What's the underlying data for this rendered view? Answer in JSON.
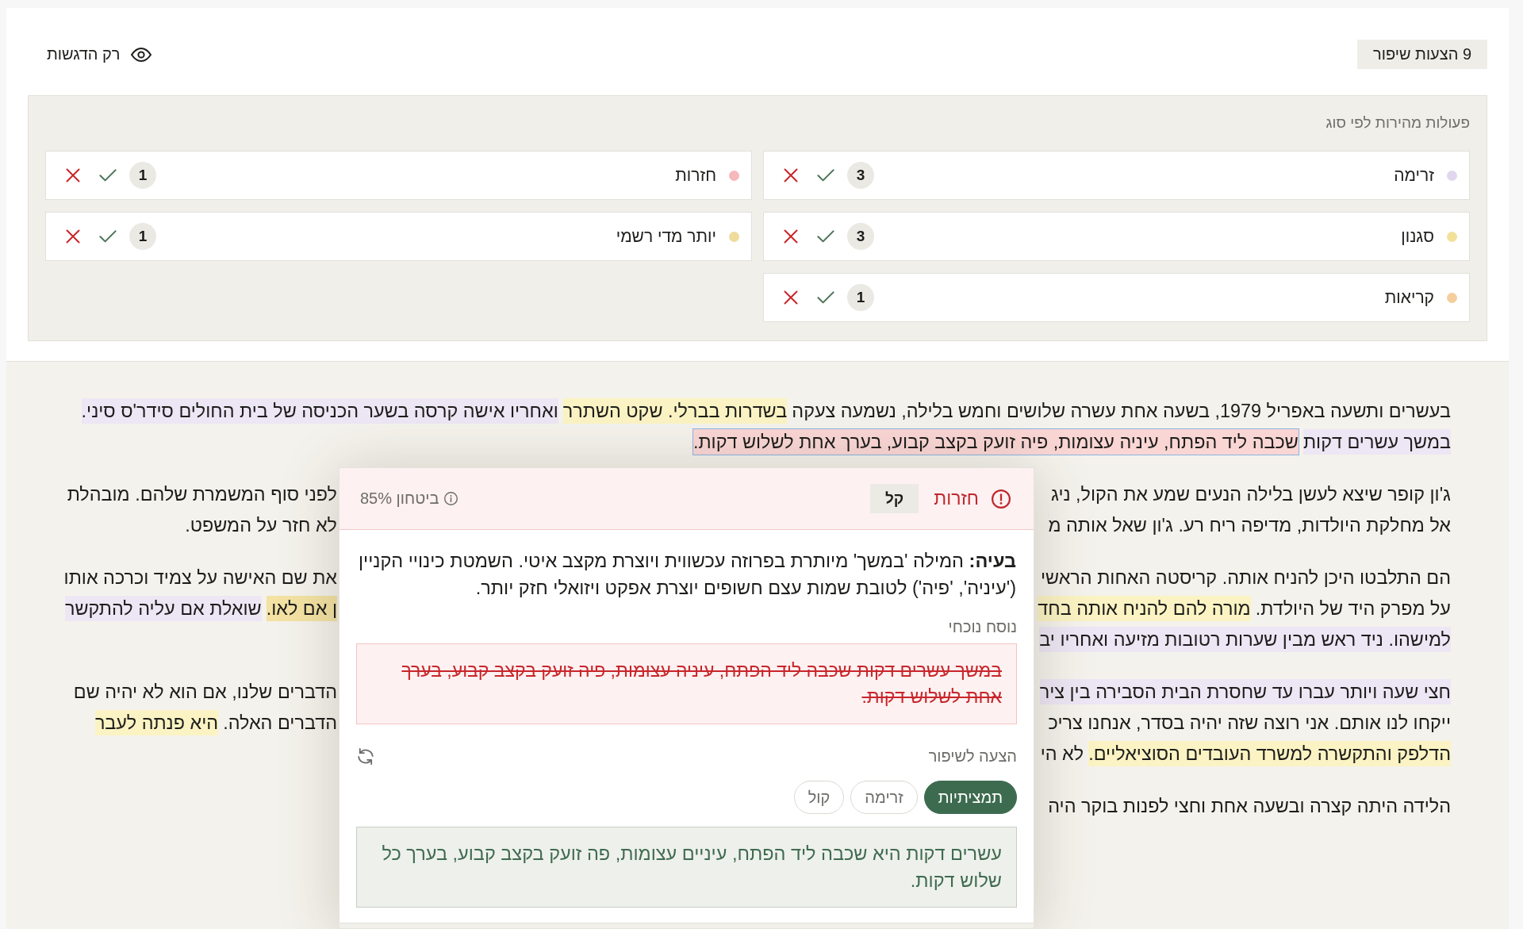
{
  "header": {
    "suggestion_count": "9 הצעות שיפור",
    "highlights_toggle": "רק הדגשות"
  },
  "quick_actions": {
    "title": "פעולות מהירות לפי סוג",
    "categories": [
      {
        "name": "זרימה",
        "color": "#e0d7ee",
        "count": "3"
      },
      {
        "name": "חזרות",
        "color": "#f5b8bb",
        "count": "1"
      },
      {
        "name": "סגנון",
        "color": "#f3e19a",
        "count": "3"
      },
      {
        "name": "יותר מדי רשמי",
        "color": "#efdb9c",
        "count": "1"
      },
      {
        "name": "קריאות",
        "color": "#f4cf9d",
        "count": "1"
      }
    ]
  },
  "document": {
    "paragraphs": [
      {
        "lines": [
          {
            "start": [
              {
                "text": "בעשרים ותשעה באפריל 1979, בשעה אחת עשרה שלושים וחמש בלילה, נשמעה צעקה"
              },
              {
                "text": "בשדרות בברלי. שקט השתרר",
                "color": "#fbf3c3",
                "selected": false
              },
              {
                "text": "ואחריו אישה קרסה בשער הכניסה של בית החולים סידר'ס סיני.",
                "color": "#ede6f5",
                "selected": false
              }
            ]
          },
          {
            "start": [
              {
                "text": "במשך עשרים דקות",
                "color": "#ede6f5",
                "selected": false
              },
              {
                "text": "שכבה ליד הפתח, עיניה עצומות, פיה זועק בקצב קבוע, בערך אחת לשלוש דקות.",
                "color": "#f9d6d4",
                "selected": true
              }
            ]
          }
        ]
      },
      {
        "lines": [
          {
            "start": [
              {
                "text": "ג'ון קופר שיצא לעשן בלילה הנעים שמע את הקול, ניג"
              }
            ],
            "end": [
              {
                "text": "לפני סוף המשמרת שלהם. מובהלת"
              }
            ]
          },
          {
            "start": [
              {
                "text": "אל מחלקת היולדות, מדיפה ריח רע. ג'ון שאל אותה מ"
              }
            ],
            "end": [
              {
                "text": "לא חזר על המשפט."
              }
            ]
          }
        ]
      },
      {
        "lines": [
          {
            "start": [
              {
                "text": "הם התלבטו היכן להניח אותה. קריסטה האחות הראשי"
              }
            ],
            "end": [
              {
                "text": "את שם האישה על צמיד וכרכה אותו"
              }
            ]
          },
          {
            "start": [
              {
                "text": "על מפרק היד של היולדת."
              },
              {
                "text": "מורה להם להניח אותה בחד",
                "color": "#fbf3c3",
                "selected": false
              }
            ],
            "end": [
              {
                "text": "ן אם לאו.",
                "color": "#f3e2a3",
                "selected": false
              },
              {
                "text": "שואלת אם עליה להתקשר",
                "color": "#ede6f5",
                "selected": false
              }
            ]
          },
          {
            "start": [
              {
                "text": "למישהו. ניד ראש מבין שערות רטובות מזיעה ואחריו יב",
                "color": "#ede6f5",
                "selected": false
              }
            ]
          }
        ]
      },
      {
        "lines": [
          {
            "start": [
              {
                "text": "חצי שעה ויותר עברו עד שחסרת הבית הסבירה בין ציר",
                "color": "#ede6f5",
                "selected": false
              }
            ],
            "end": [
              {
                "text": "הדברים שלנו, אם הוא לא יהיה שם"
              }
            ]
          },
          {
            "start": [
              {
                "text": "ייקחו לנו אותם. אני רוצה שזה יהיה בסדר, אנחנו צריכ"
              }
            ],
            "end": [
              {
                "text": "הדברים האלה."
              },
              {
                "text": "היא פנתה לעבר",
                "color": "#fbf3c3",
                "selected": false
              }
            ]
          },
          {
            "start": [
              {
                "text": "הדלפק והתקשרה למשרד העובדים הסוציאליים.",
                "color": "#fbf3c3",
                "selected": false
              },
              {
                "text": "לא הי"
              }
            ]
          }
        ]
      },
      {
        "lines": [
          {
            "start": [
              {
                "text": "הלידה היתה קצרה ובשעה אחת וחצי לפנות בוקר היה"
              }
            ]
          }
        ]
      }
    ]
  },
  "popover": {
    "category": "חזרות",
    "severity": "קל",
    "confidence": "ביטחון 85%",
    "explanation": "**בעיה:** המילה 'במשך' מיותרת בפרוזה עכשווית ויוצרת מקצב איטי. השמטת כינויי הקניין ('עיניה', 'פיה') לטובת שמות עצם חשופים יוצרת אפקט ויזואלי חזק יותר.",
    "current_label": "נוסח נוכחי",
    "current_text": "במשך עשרים דקות שכבה ליד הפתח, עיניה עצומות, פיה זועק בקצב קבוע, בערך אחת לשלוש דקות.",
    "suggestion_label": "הצעה לשיפור",
    "styles": [
      {
        "label": "תמציתיות",
        "selected": true
      },
      {
        "label": "זרימה",
        "selected": false
      },
      {
        "label": "קול",
        "selected": false
      }
    ],
    "suggestion_text": "עשרים דקות היא שכבה ליד הפתח, עיניים עצומות, פה זועק בקצב קבוע, בערך כל שלוש דקות."
  }
}
